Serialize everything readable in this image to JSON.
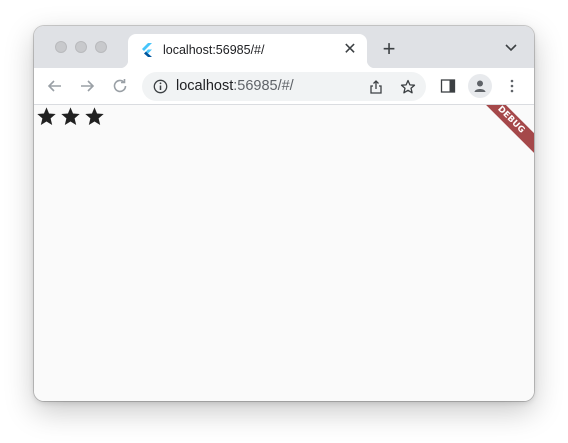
{
  "browser": {
    "tab": {
      "title": "localhost:56985/#/",
      "favicon": "flutter-icon",
      "close_glyph": "✕"
    },
    "new_tab_glyph": "+",
    "address": {
      "host": "localhost",
      "rest": ":56985/#/"
    },
    "icons": {
      "back": "back-arrow-icon",
      "forward": "forward-arrow-icon",
      "reload": "reload-icon",
      "site_info": "info-icon",
      "share": "share-icon",
      "bookmark": "star-icon",
      "side_panel": "side-panel-icon",
      "profile": "profile-icon",
      "menu": "kebab-menu-icon",
      "tab_search": "chevron-down-icon"
    }
  },
  "app": {
    "rating": {
      "filled": 3,
      "total": 3
    },
    "debug_banner": "DEBUG",
    "colors": {
      "background": "#fafafa",
      "star": "#212121",
      "banner": "#a5484a"
    }
  }
}
